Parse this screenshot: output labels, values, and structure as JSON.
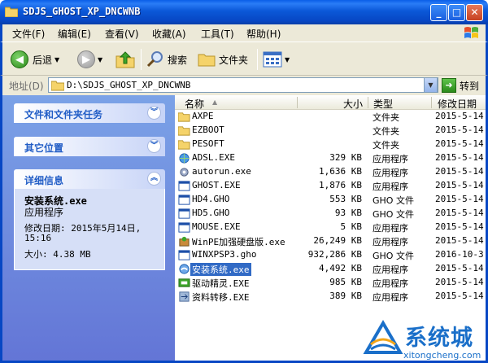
{
  "window": {
    "title": "SDJS_GHOST_XP_DNCWNB",
    "minimize": "_",
    "maximize": "□",
    "close": "✕"
  },
  "menu": [
    "文件(F)",
    "编辑(E)",
    "查看(V)",
    "收藏(A)",
    "工具(T)",
    "帮助(H)"
  ],
  "toolbar": {
    "back": "后退",
    "search": "搜索",
    "folders": "文件夹"
  },
  "address": {
    "label": "地址(D)",
    "path": "D:\\SDJS_GHOST_XP_DNCWNB",
    "go": "转到"
  },
  "sidebar": {
    "panels": [
      "文件和文件夹任务",
      "其它位置",
      "详细信息"
    ],
    "details": {
      "name": "安装系统.exe",
      "type": "应用程序",
      "modified_line1": "修改日期: 2015年5月14日,",
      "modified_line2": "15:16",
      "size": "大小: 4.38 MB"
    }
  },
  "columns": {
    "name": "名称",
    "size": "大小",
    "type": "类型",
    "date": "修改日期"
  },
  "files": [
    {
      "name": "AXPE",
      "size": "",
      "type": "文件夹",
      "date": "2015-5-14",
      "icon": "folder-icon"
    },
    {
      "name": "EZBOOT",
      "size": "",
      "type": "文件夹",
      "date": "2015-5-14",
      "icon": "folder-icon"
    },
    {
      "name": "PESOFT",
      "size": "",
      "type": "文件夹",
      "date": "2015-5-14",
      "icon": "folder-icon"
    },
    {
      "name": "ADSL.EXE",
      "size": "329 KB",
      "type": "应用程序",
      "date": "2015-5-14",
      "icon": "globe-icon"
    },
    {
      "name": "autorun.exe",
      "size": "1,636 KB",
      "type": "应用程序",
      "date": "2015-5-14",
      "icon": "gear-icon"
    },
    {
      "name": "GHOST.EXE",
      "size": "1,876 KB",
      "type": "应用程序",
      "date": "2015-5-14",
      "icon": "window-icon"
    },
    {
      "name": "HD4.GHO",
      "size": "553 KB",
      "type": "GHO 文件",
      "date": "2015-5-14",
      "icon": "window-icon"
    },
    {
      "name": "HD5.GHO",
      "size": "93 KB",
      "type": "GHO 文件",
      "date": "2015-5-14",
      "icon": "window-icon"
    },
    {
      "name": "MOUSE.EXE",
      "size": "5 KB",
      "type": "应用程序",
      "date": "2015-5-14",
      "icon": "window-icon"
    },
    {
      "name": "WinPE加强硬盘版.exe",
      "size": "26,249 KB",
      "type": "应用程序",
      "date": "2015-5-14",
      "icon": "setup-icon"
    },
    {
      "name": "WINXPSP3.gho",
      "size": "932,286 KB",
      "type": "GHO 文件",
      "date": "2016-10-3",
      "icon": "window-icon"
    },
    {
      "name": "安装系统.exe",
      "size": "4,492 KB",
      "type": "应用程序",
      "date": "2015-5-14",
      "icon": "install-icon"
    },
    {
      "name": "驱动精灵.EXE",
      "size": "985 KB",
      "type": "应用程序",
      "date": "2015-5-14",
      "icon": "driver-icon"
    },
    {
      "name": "资料转移.EXE",
      "size": "389 KB",
      "type": "应用程序",
      "date": "2015-5-14",
      "icon": "transfer-icon"
    }
  ],
  "selected_file": "安装系统.exe",
  "watermark": {
    "text": "系统城",
    "url": "xitongcheng.com"
  },
  "colors": {
    "titlebar": "#0747c4",
    "sidebar": "#6f8fdf",
    "selection": "#316ac5",
    "watermark": "#1a6fc9"
  }
}
